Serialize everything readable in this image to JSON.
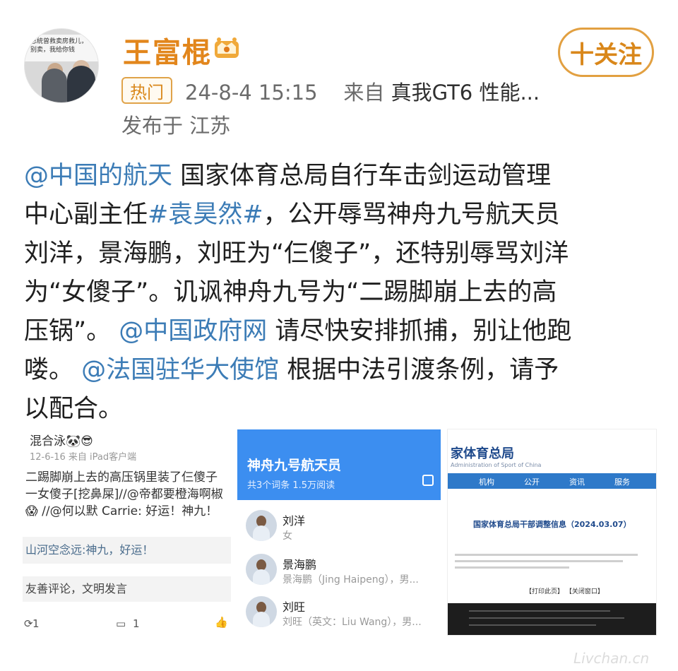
{
  "header": {
    "username": "王富棍",
    "follow_label": "十关注",
    "hot_badge": "热门",
    "timestamp": "24-8-4 15:15",
    "source_prefix": "来自",
    "source_device": "真我GT6 性能...",
    "location": "发布于 江苏",
    "avatar_caption": "总统曾救卖房救儿，别卖，我给你钱",
    "accent_color": "#e2861c"
  },
  "post": {
    "link_color": "#3c7cb6",
    "lines": [
      [
        {
          "t": "@中国的航天",
          "link": true
        },
        {
          "t": " 国家体育总局自行车击剑运动管理",
          "link": false
        }
      ],
      [
        {
          "t": "中心副主任",
          "link": false
        },
        {
          "t": "#袁昊然#",
          "link": true
        },
        {
          "t": "，公开辱骂神舟九号航天员",
          "link": false
        }
      ],
      [
        {
          "t": "刘洋，景海鹏，刘旺为“仨傻子”，还特别辱骂刘洋",
          "link": false
        }
      ],
      [
        {
          "t": "为“女傻子”。讥讽神舟九号为“二踢脚崩上去的高",
          "link": false
        }
      ],
      [
        {
          "t": "压锅”。 ",
          "link": false
        },
        {
          "t": "@中国政府网",
          "link": true
        },
        {
          "t": " 请尽快安排抓捕，别让他跑",
          "link": false
        }
      ],
      [
        {
          "t": "喽。 ",
          "link": false
        },
        {
          "t": "@法国驻华大使馆",
          "link": true
        },
        {
          "t": " 根据中法引渡条例，请予",
          "link": false
        }
      ],
      [
        {
          "t": "以配合。",
          "link": false
        }
      ]
    ]
  },
  "shot1": {
    "user": "混合泳🐼😎",
    "date": "12-6-16  来自 iPad客户端",
    "lines": [
      "二踢脚崩上去的高压锅里装了仨傻子",
      "一女傻子[挖鼻屎]//@帝都要橙海啊椒",
      "😱 //@何以默 Carrie: 好运！神九！"
    ],
    "comment": "山河空念远:神九，好运！",
    "reply_hint": "友善评论，文明发言",
    "repost_count": "1",
    "comment_count": "1"
  },
  "shot2": {
    "title": "神舟九号航天员",
    "subtitle": "共3个词条  1.5万阅读",
    "items": [
      {
        "name": "刘洋",
        "desc": "女"
      },
      {
        "name": "景海鹏",
        "desc": "景海鹏（Jing Haipeng），男..."
      },
      {
        "name": "刘旺",
        "desc": "刘旺（英文：Liu Wang），男..."
      }
    ]
  },
  "shot3": {
    "title": "家体育总局",
    "subtitle": "Administration of Sport of China",
    "nav": [
      "机构",
      "公开",
      "资讯",
      "服务"
    ],
    "heading": "国家体育总局干部调整信息（2024.03.07）",
    "links": "【打印此页】 【关闭窗口】"
  },
  "watermark": "Livchan.cn"
}
